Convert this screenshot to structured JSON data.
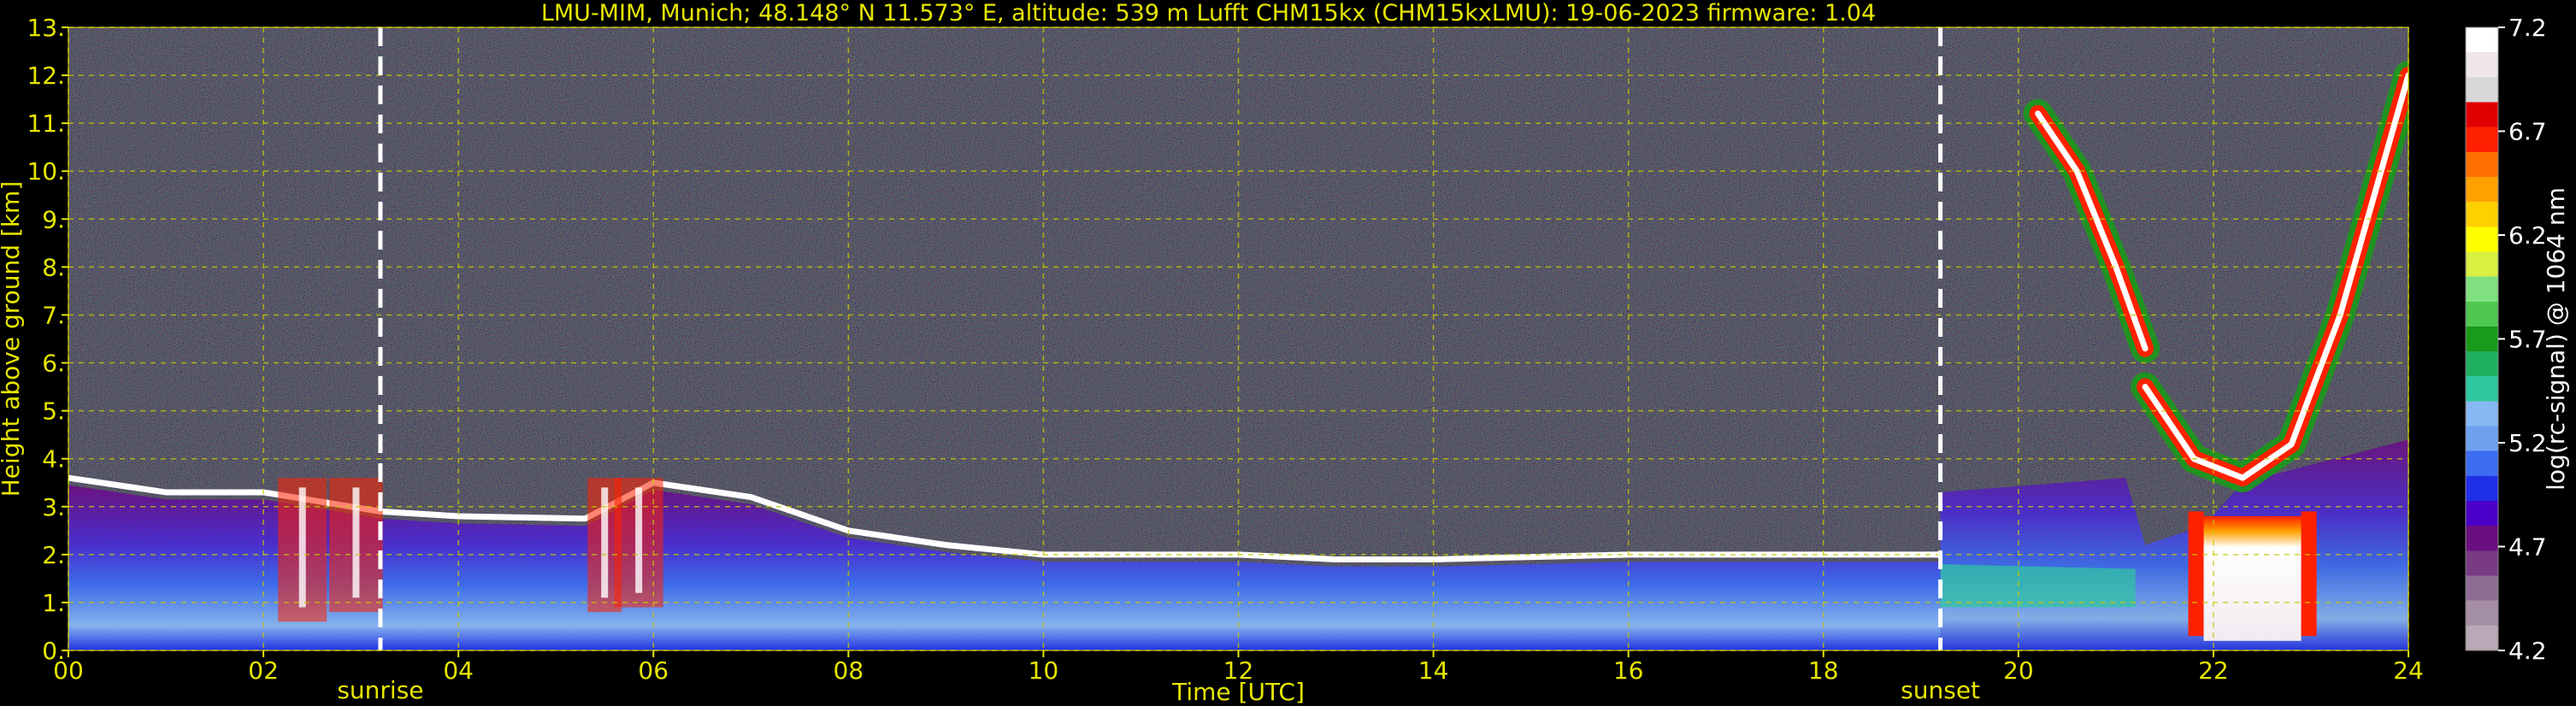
{
  "chart_data": {
    "type": "heatmap",
    "title": "LMU-MIM, Munich; 48.148° N 11.573° E, altitude: 539 m    Lufft CHM15kx (CHM15kxLMU): 19-06-2023    firmware: 1.04",
    "xlabel": "Time [UTC]",
    "ylabel": "Height above ground [km]",
    "xlim": [
      0,
      24
    ],
    "ylim": [
      0,
      13
    ],
    "x_ticks": [
      "00",
      "02",
      "04",
      "06",
      "08",
      "10",
      "12",
      "14",
      "16",
      "18",
      "20",
      "22",
      "24"
    ],
    "y_ticks": [
      "0.",
      "1.",
      "2.",
      "3.",
      "4.",
      "5.",
      "6.",
      "7.",
      "8.",
      "9.",
      "10.",
      "11.",
      "12.",
      "13."
    ],
    "grid": true,
    "colorbar": {
      "label": "log(rc-signal) @ 1064 nm",
      "range": [
        4.2,
        7.2
      ],
      "ticks": [
        "4.2",
        "4.7",
        "5.2",
        "5.7",
        "6.2",
        "6.7",
        "7.2"
      ],
      "colors": [
        "#b9a8b6",
        "#a58fa6",
        "#8f6d94",
        "#7a3b86",
        "#6b0f80",
        "#4a00c8",
        "#1f2fe8",
        "#3c6cf0",
        "#6ea0f0",
        "#88b8f4",
        "#2ec8a0",
        "#20b060",
        "#1a9a1a",
        "#4ec84e",
        "#80e080",
        "#d8f040",
        "#ffff00",
        "#ffd000",
        "#ffa000",
        "#ff7000",
        "#ff2000",
        "#e00000",
        "#d8d8d8",
        "#efe6ec",
        "#ffffff"
      ]
    },
    "events": [
      {
        "label": "sunrise",
        "time": 3.2
      },
      {
        "label": "sunset",
        "time": 19.2
      }
    ],
    "features": [
      {
        "name": "boundary-layer-top",
        "points": [
          [
            0,
            3.6
          ],
          [
            1,
            3.3
          ],
          [
            2,
            3.3
          ],
          [
            3.2,
            2.9
          ],
          [
            4,
            2.8
          ],
          [
            5.3,
            2.75
          ],
          [
            6,
            3.5
          ],
          [
            7,
            3.2
          ],
          [
            8,
            2.5
          ],
          [
            9,
            2.2
          ],
          [
            10,
            2.0
          ],
          [
            11,
            2.0
          ],
          [
            12,
            2.0
          ],
          [
            13,
            1.9
          ],
          [
            14,
            1.9
          ],
          [
            16,
            2.0
          ],
          [
            18,
            2.0
          ],
          [
            19.2,
            2.0
          ]
        ]
      },
      {
        "name": "cirrus-left-branch",
        "points": [
          [
            20.2,
            11.2
          ],
          [
            20.6,
            10.0
          ],
          [
            21.0,
            8.0
          ],
          [
            21.3,
            6.3
          ]
        ]
      },
      {
        "name": "cirrus-right-branch",
        "points": [
          [
            21.3,
            5.5
          ],
          [
            21.8,
            4.0
          ],
          [
            22.3,
            3.6
          ],
          [
            22.8,
            4.3
          ],
          [
            23.3,
            7.0
          ],
          [
            24,
            12.0
          ]
        ]
      },
      {
        "name": "dense-cloud-base",
        "points": [
          [
            21.9,
            2.8
          ],
          [
            22.9,
            2.8
          ]
        ]
      }
    ]
  }
}
